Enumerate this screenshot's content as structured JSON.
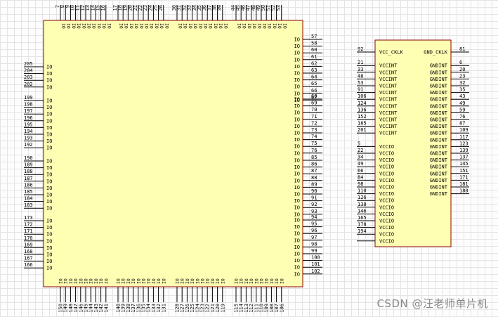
{
  "watermark": "CSDN @汪老师单片机",
  "colors": {
    "body_fill": "#ffffb4",
    "body_stroke": "#8b0000",
    "pin_line": "#000000",
    "text": "#000000",
    "grid": "#e4e4e4"
  },
  "main_component": {
    "top_pins": [
      {
        "group": [
          7,
          8,
          9,
          10,
          11,
          12,
          13,
          14,
          15,
          16
        ]
      },
      {
        "group": [
          17,
          18,
          19,
          20,
          21,
          22,
          23,
          24,
          25,
          26
        ]
      },
      {
        "group": [
          30,
          31,
          32,
          33,
          34,
          35,
          36,
          37,
          38,
          39
        ]
      },
      {
        "group": [
          44,
          45,
          46,
          47,
          48,
          49,
          50,
          51,
          52,
          53
        ]
      }
    ],
    "bottom_pins": [
      {
        "group": [
          150,
          149,
          148,
          147,
          146,
          145,
          144,
          143,
          142,
          141
        ]
      },
      {
        "group": [
          140,
          139,
          138,
          137,
          136,
          135,
          134,
          133,
          132,
          131
        ]
      },
      {
        "group": [
          128,
          127,
          126,
          125,
          124,
          123,
          122,
          121,
          120,
          119
        ]
      },
      {
        "group": [
          115,
          114,
          113,
          112,
          111,
          110,
          109,
          108,
          107,
          106
        ]
      }
    ],
    "left_pins": [
      {
        "group": [
          205,
          204,
          203,
          202
        ]
      },
      {
        "group": [
          199,
          198,
          197,
          196,
          195,
          194,
          193,
          192
        ]
      },
      {
        "group": [
          190,
          189,
          188,
          187,
          186,
          185,
          184,
          183
        ]
      },
      {
        "group": [
          173,
          172,
          171,
          170,
          169,
          168,
          167,
          166
        ]
      }
    ],
    "right_pins": [
      {
        "group": [
          57,
          58,
          60,
          61,
          62,
          63,
          64,
          65,
          66,
          67
        ]
      },
      {
        "group": [
          68,
          69,
          70,
          71,
          72,
          73,
          74,
          75,
          76
        ]
      },
      {
        "group": [
          85,
          86,
          87,
          88,
          89,
          90,
          91,
          92,
          93
        ]
      },
      {
        "group": [
          94,
          95,
          96,
          97,
          98,
          99,
          100,
          101,
          102
        ]
      }
    ],
    "pin_label": "IO"
  },
  "power_component": {
    "left_pins": [
      {
        "num": "92",
        "label": "VCC_CKLK"
      },
      {
        "num": "",
        "label": ""
      },
      {
        "num": "21",
        "label": "VCCINT"
      },
      {
        "num": "33",
        "label": "VCCINT"
      },
      {
        "num": "48",
        "label": "VCCINT"
      },
      {
        "num": "53",
        "label": "VCCINT"
      },
      {
        "num": "91",
        "label": "VCCINT"
      },
      {
        "num": "106",
        "label": "VCCINT"
      },
      {
        "num": "124",
        "label": "VCCINT"
      },
      {
        "num": "136",
        "label": "VCCINT"
      },
      {
        "num": "152",
        "label": "VCCINT"
      },
      {
        "num": "185",
        "label": "VCCINT"
      },
      {
        "num": "201",
        "label": "VCCINT"
      },
      {
        "num": "",
        "label": ""
      },
      {
        "num": "5",
        "label": "VCCIO"
      },
      {
        "num": "22",
        "label": "VCCIO"
      },
      {
        "num": "34",
        "label": "VCCIO"
      },
      {
        "num": "49",
        "label": "VCCIO"
      },
      {
        "num": "66",
        "label": "VCCIO"
      },
      {
        "num": "84",
        "label": "VCCIO"
      },
      {
        "num": "98",
        "label": "VCCIO"
      },
      {
        "num": "110",
        "label": "VCCIO"
      },
      {
        "num": "126",
        "label": "VCCIO"
      },
      {
        "num": "138",
        "label": "VCCIO"
      },
      {
        "num": "146",
        "label": "VCCIO"
      },
      {
        "num": "165",
        "label": "VCCIO"
      },
      {
        "num": "178",
        "label": "VCCIO"
      },
      {
        "num": "194",
        "label": "VCCIO"
      },
      {
        "num": "",
        "label": "VCCIO"
      }
    ],
    "right_pins": [
      {
        "num": "81",
        "label": "GND_CKLK"
      },
      {
        "num": "",
        "label": ""
      },
      {
        "num": "6",
        "label": "GNDINT"
      },
      {
        "num": "20",
        "label": "GNDINT"
      },
      {
        "num": "23",
        "label": "GNDINT"
      },
      {
        "num": "32",
        "label": "GNDINT"
      },
      {
        "num": "35",
        "label": "GNDINT"
      },
      {
        "num": "43",
        "label": "GNDINT"
      },
      {
        "num": "49",
        "label": "GNDINT"
      },
      {
        "num": "59",
        "label": "GNDINT"
      },
      {
        "num": "76",
        "label": "GNDINT"
      },
      {
        "num": "87",
        "label": "GNDINT"
      },
      {
        "num": "109",
        "label": "GNDINT"
      },
      {
        "num": "117",
        "label": "GNDINT"
      },
      {
        "num": "123",
        "label": "GNDINT"
      },
      {
        "num": "139",
        "label": "GNDINT"
      },
      {
        "num": "137",
        "label": "GNDINT"
      },
      {
        "num": "145",
        "label": "GNDINT"
      },
      {
        "num": "151",
        "label": "GNDINT"
      },
      {
        "num": "171",
        "label": "GNDINT"
      },
      {
        "num": "181",
        "label": "GNDINT"
      },
      {
        "num": "188",
        "label": "GNDINT"
      }
    ]
  }
}
